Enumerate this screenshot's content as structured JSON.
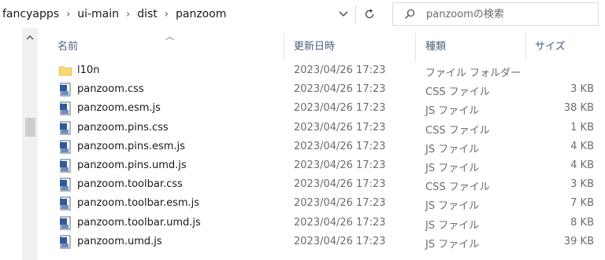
{
  "breadcrumb": [
    "fancyapps",
    "ui-main",
    "dist",
    "panzoom"
  ],
  "search": {
    "placeholder": "panzoomの検索"
  },
  "columns": {
    "name": "名前",
    "date": "更新日時",
    "type": "種類",
    "size": "サイズ"
  },
  "files": [
    {
      "name": "l10n",
      "date": "2023/04/26 17:23",
      "type": "ファイル フォルダー",
      "size": "",
      "icon": "folder-icon"
    },
    {
      "name": "panzoom.css",
      "date": "2023/04/26 17:23",
      "type": "CSS ファイル",
      "size": "3 KB",
      "icon": "file-icon"
    },
    {
      "name": "panzoom.esm.js",
      "date": "2023/04/26 17:23",
      "type": "JS ファイル",
      "size": "38 KB",
      "icon": "file-icon"
    },
    {
      "name": "panzoom.pins.css",
      "date": "2023/04/26 17:23",
      "type": "CSS ファイル",
      "size": "1 KB",
      "icon": "file-icon"
    },
    {
      "name": "panzoom.pins.esm.js",
      "date": "2023/04/26 17:23",
      "type": "JS ファイル",
      "size": "4 KB",
      "icon": "file-icon"
    },
    {
      "name": "panzoom.pins.umd.js",
      "date": "2023/04/26 17:23",
      "type": "JS ファイル",
      "size": "4 KB",
      "icon": "file-icon"
    },
    {
      "name": "panzoom.toolbar.css",
      "date": "2023/04/26 17:23",
      "type": "CSS ファイル",
      "size": "3 KB",
      "icon": "file-icon"
    },
    {
      "name": "panzoom.toolbar.esm.js",
      "date": "2023/04/26 17:23",
      "type": "JS ファイル",
      "size": "7 KB",
      "icon": "file-icon"
    },
    {
      "name": "panzoom.toolbar.umd.js",
      "date": "2023/04/26 17:23",
      "type": "JS ファイル",
      "size": "8 KB",
      "icon": "file-icon"
    },
    {
      "name": "panzoom.umd.js",
      "date": "2023/04/26 17:23",
      "type": "JS ファイル",
      "size": "39 KB",
      "icon": "file-icon"
    }
  ]
}
